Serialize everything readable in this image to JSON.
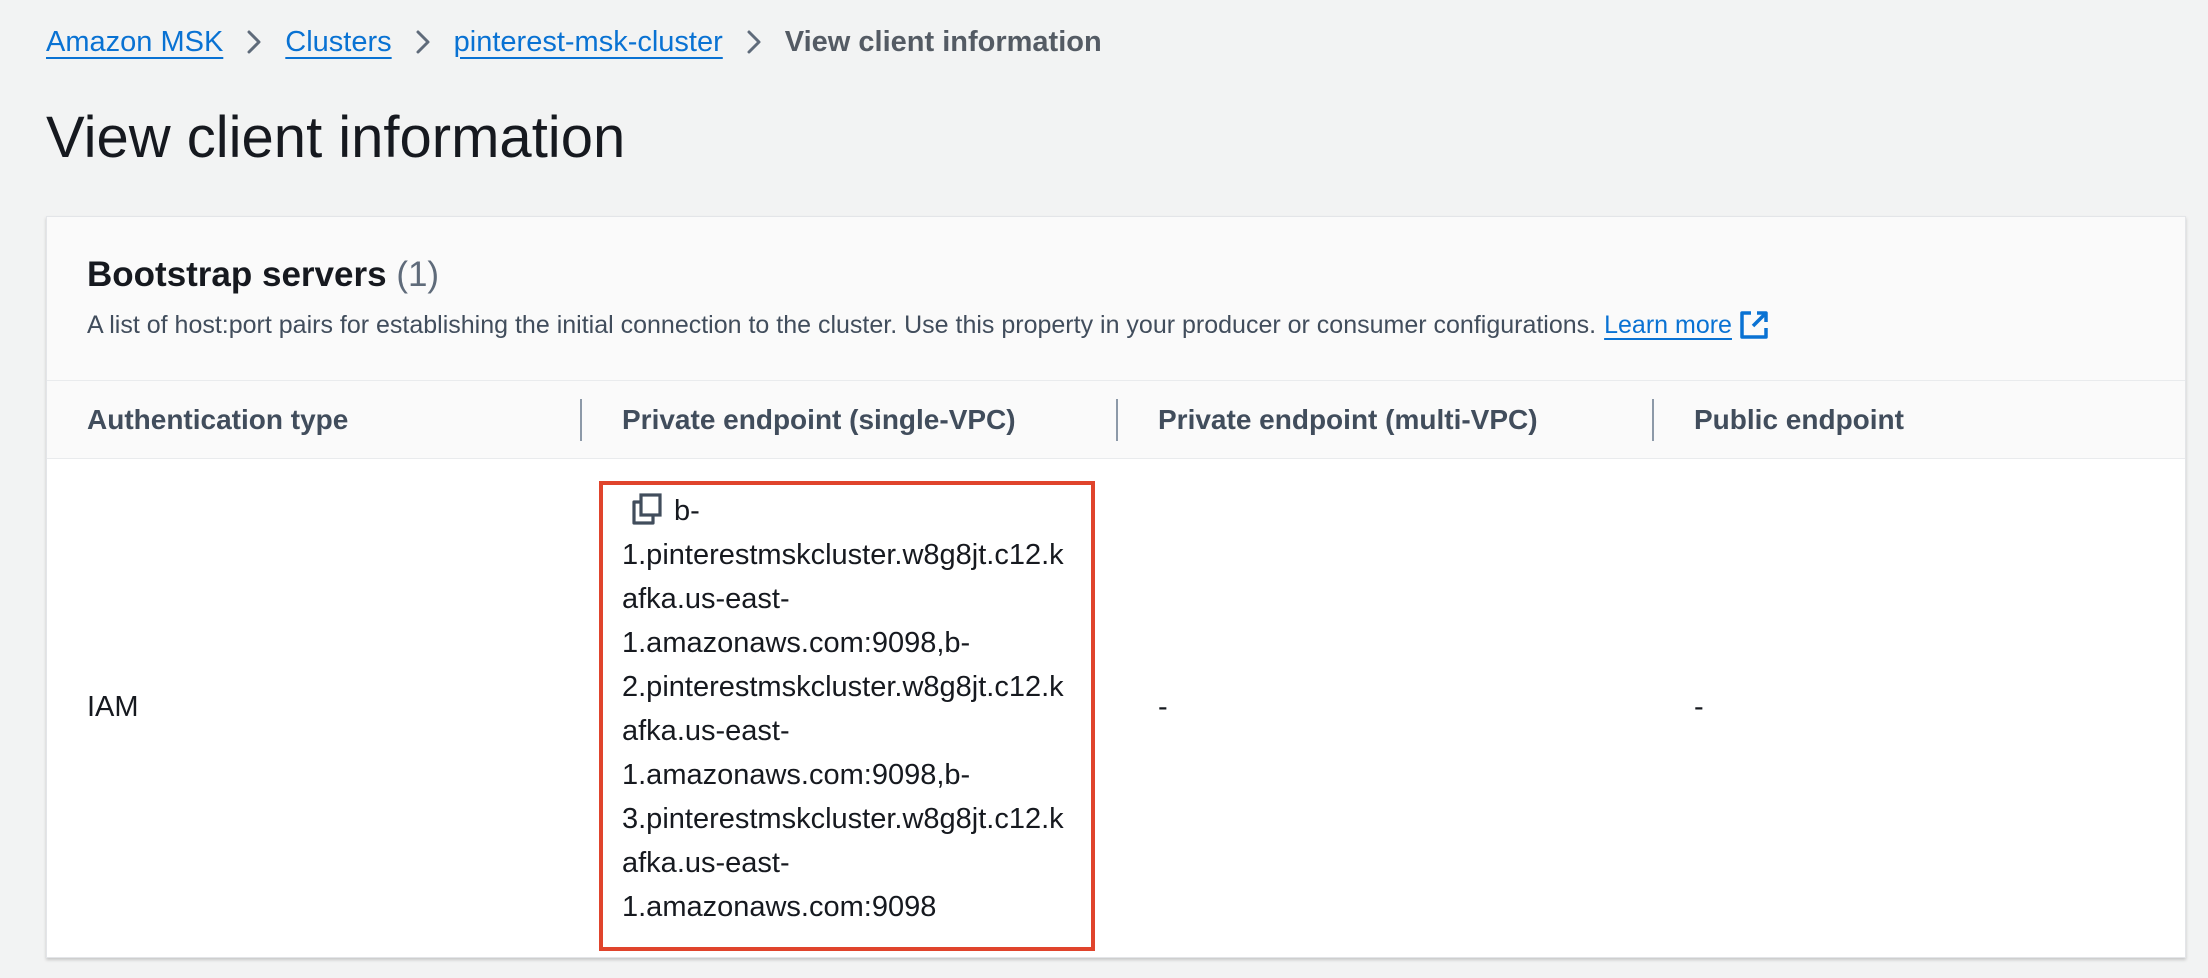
{
  "breadcrumb": {
    "items": [
      "Amazon MSK",
      "Clusters",
      "pinterest-msk-cluster"
    ],
    "current": "View client information"
  },
  "page": {
    "title": "View client information"
  },
  "panel": {
    "title": "Bootstrap servers",
    "count": "(1)",
    "description": "A list of host:port pairs for establishing the initial connection to the cluster. Use this property in your producer or consumer configurations.",
    "learn_more": "Learn more"
  },
  "table": {
    "columns": [
      "Authentication type",
      "Private endpoint (single-VPC)",
      "Private endpoint (multi-VPC)",
      "Public endpoint"
    ],
    "rows": [
      {
        "auth_type": "IAM",
        "private_single_vpc_lines": [
          "b-",
          "1.pinterestmskcluster.w8g8jt.c12.k",
          "afka.us-east-",
          "1.amazonaws.com:9098,b-",
          "2.pinterestmskcluster.w8g8jt.c12.k",
          "afka.us-east-",
          "1.amazonaws.com:9098,b-",
          "3.pinterestmskcluster.w8g8jt.c12.k",
          "afka.us-east-",
          "1.amazonaws.com:9098"
        ],
        "private_multi_vpc": "-",
        "public": "-"
      }
    ]
  },
  "icons": {
    "breadcrumb_separator": "chevron-right-icon",
    "learn_more": "external-link-icon",
    "copy": "copy-icon"
  },
  "colors": {
    "link": "#0972d3",
    "highlight": "#e0442c",
    "background": "#f2f3f3"
  }
}
